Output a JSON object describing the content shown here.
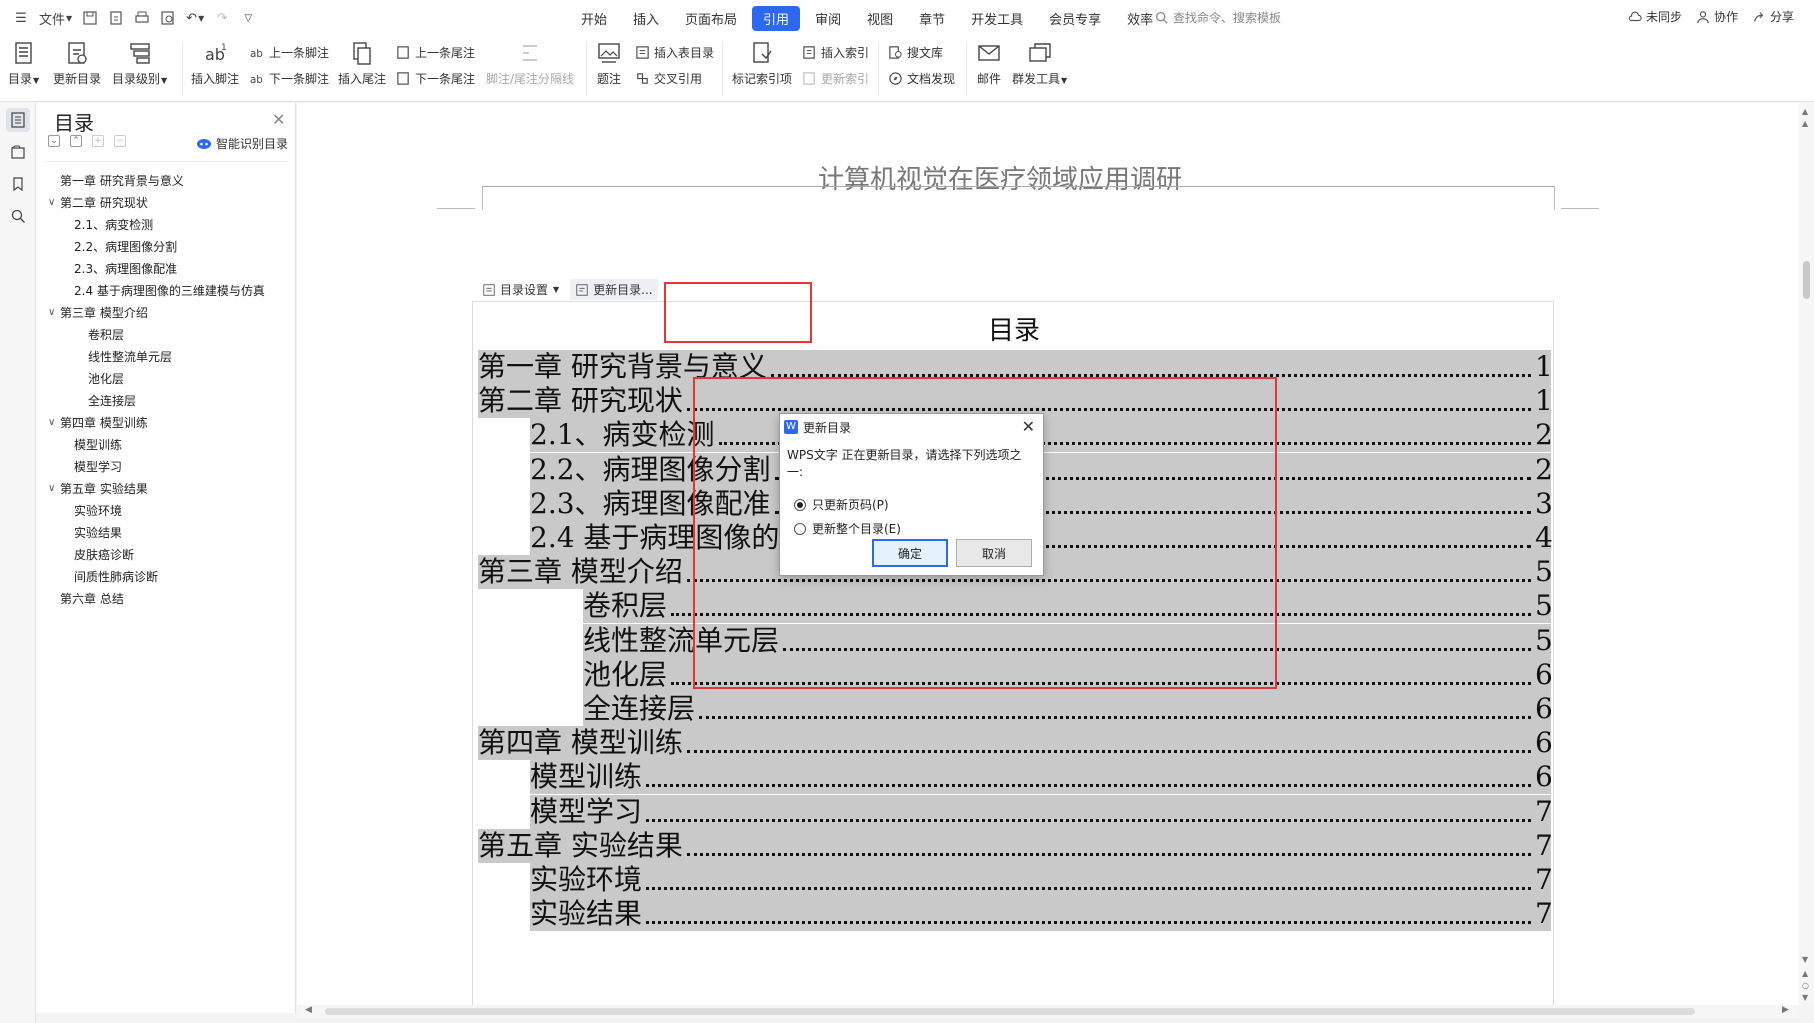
{
  "menubar": {
    "file_label": "文件",
    "tabs": [
      "开始",
      "插入",
      "页面布局",
      "引用",
      "审阅",
      "视图",
      "章节",
      "开发工具",
      "会员专享",
      "效率"
    ],
    "active_tab": "引用",
    "search_placeholder": "查找命令、搜索模板",
    "right": {
      "sync": "未同步",
      "collab": "协作",
      "share": "分享"
    }
  },
  "ribbon": {
    "toc": "目录",
    "update_toc": "更新目录",
    "toc_level": "目录级别",
    "insert_footnote": "插入脚注",
    "prev_footnote": "上一条脚注",
    "next_footnote": "下一条脚注",
    "insert_endnote": "插入尾注",
    "prev_endnote": "上一条尾注",
    "next_endnote": "下一条尾注",
    "separator_line": "脚注/尾注分隔线",
    "caption": "题注",
    "insert_table_of_figures": "插入表目录",
    "cross_reference": "交叉引用",
    "mark_index": "标记索引项",
    "insert_index": "插入索引",
    "update_index": "更新索引",
    "search_library": "搜文库",
    "doc_discover": "文档发现",
    "mail": "邮件",
    "mass_tools": "群发工具"
  },
  "toc_panel": {
    "title": "目录",
    "smart_toc": "智能识别目录",
    "items": [
      {
        "label": "第一章  研究背景与意义",
        "level": 0,
        "arrow": ""
      },
      {
        "label": "第二章  研究现状",
        "level": 0,
        "arrow": "∨"
      },
      {
        "label": "2.1、病变检测",
        "level": 1,
        "arrow": ""
      },
      {
        "label": "2.2、病理图像分割",
        "level": 1,
        "arrow": ""
      },
      {
        "label": "2.3、病理图像配准",
        "level": 1,
        "arrow": ""
      },
      {
        "label": "2.4  基于病理图像的三维建模与仿真",
        "level": 1,
        "arrow": ""
      },
      {
        "label": "第三章  模型介绍",
        "level": 0,
        "arrow": "∨"
      },
      {
        "label": "卷积层",
        "level": 2,
        "arrow": ""
      },
      {
        "label": "线性整流单元层",
        "level": 2,
        "arrow": ""
      },
      {
        "label": "池化层",
        "level": 2,
        "arrow": ""
      },
      {
        "label": "全连接层",
        "level": 2,
        "arrow": ""
      },
      {
        "label": "第四章    模型训练",
        "level": 0,
        "arrow": "∨"
      },
      {
        "label": "模型训练",
        "level": 1,
        "arrow": ""
      },
      {
        "label": "模型学习",
        "level": 1,
        "arrow": ""
      },
      {
        "label": "第五章  实验结果",
        "level": 0,
        "arrow": "∨"
      },
      {
        "label": "实验环境",
        "level": 1,
        "arrow": ""
      },
      {
        "label": "实验结果",
        "level": 1,
        "arrow": ""
      },
      {
        "label": "皮肤癌诊断",
        "level": 1,
        "arrow": ""
      },
      {
        "label": "间质性肺病诊断",
        "level": 1,
        "arrow": ""
      },
      {
        "label": "第六章  总结",
        "level": 0,
        "arrow": ""
      }
    ]
  },
  "document": {
    "title": "计算机视觉在医疗领域应用调研",
    "toc_settings": "目录设置",
    "update_toc_btn": "更新目录...",
    "toc_heading": "目录",
    "entries": [
      {
        "text": "第一章  研究背景与意义",
        "page": "1",
        "level": 0
      },
      {
        "text": "第二章  研究现状",
        "page": "1",
        "level": 0
      },
      {
        "text": "2.1、病变检测",
        "page": "2",
        "level": 1
      },
      {
        "text": "2.2、病理图像分割",
        "page": "2",
        "level": 1
      },
      {
        "text": "2.3、病理图像配准",
        "page": "3",
        "level": 1
      },
      {
        "text": "2.4  基于病理图像的三维建模与仿真",
        "page": "4",
        "level": 1
      },
      {
        "text": "第三章  模型介绍",
        "page": "5",
        "level": 0
      },
      {
        "text": "卷积层",
        "page": "5",
        "level": 2
      },
      {
        "text": "线性整流单元层",
        "page": "5",
        "level": 2
      },
      {
        "text": "池化层",
        "page": "6",
        "level": 2
      },
      {
        "text": "全连接层",
        "page": "6",
        "level": 2
      },
      {
        "text": "第四章    模型训练",
        "page": "6",
        "level": 0
      },
      {
        "text": "模型训练",
        "page": "6",
        "level": 1
      },
      {
        "text": "模型学习",
        "page": "7",
        "level": 1
      },
      {
        "text": "第五章  实验结果",
        "page": "7",
        "level": 0
      },
      {
        "text": "实验环境",
        "page": "7",
        "level": 1
      },
      {
        "text": "实验结果",
        "page": "7",
        "level": 1
      }
    ]
  },
  "dialog": {
    "title": "更新目录",
    "message": "WPS文字 正在更新目录，请选择下列选项之一:",
    "option_pages": "只更新页码(P)",
    "option_all": "更新整个目录(E)",
    "selected": "pages",
    "ok": "确定",
    "cancel": "取消"
  },
  "colors": {
    "accent": "#2c68f0",
    "highlight_box": "#e53535",
    "toc_shade": "#c9c9c9"
  }
}
